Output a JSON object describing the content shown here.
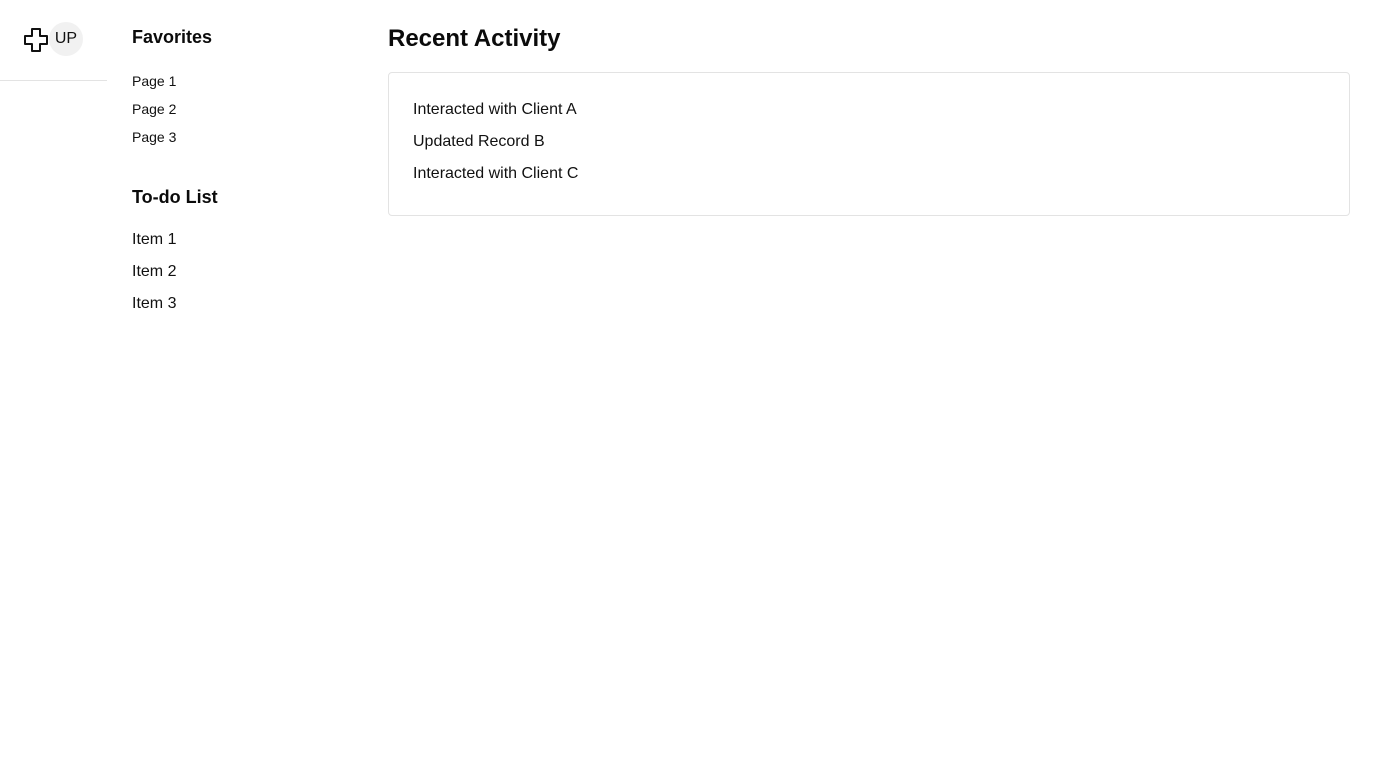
{
  "header": {
    "logo_icon": "plus-outline-icon",
    "avatar_initials": "UP"
  },
  "sidebar": {
    "favorites": {
      "title": "Favorites",
      "items": [
        "Page 1",
        "Page 2",
        "Page 3"
      ]
    },
    "todo": {
      "title": "To-do List",
      "items": [
        "Item 1",
        "Item 2",
        "Item 3"
      ]
    }
  },
  "main": {
    "title": "Recent Activity",
    "activities": [
      "Interacted with Client A",
      "Updated Record B",
      "Interacted with Client C"
    ]
  },
  "colors": {
    "text": "#111111",
    "border": "#e3e3e3",
    "avatar_bg": "#f1f1f1"
  }
}
